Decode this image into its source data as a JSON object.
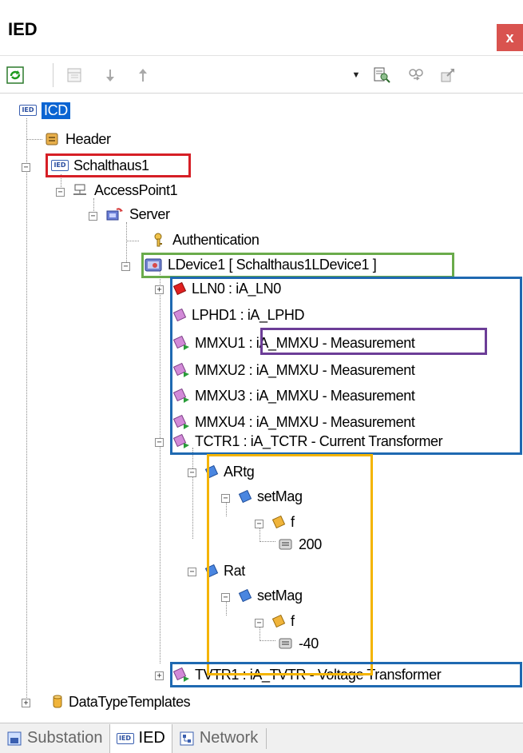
{
  "window": {
    "title": "IED",
    "close": "x"
  },
  "toolbar": {
    "icons": [
      "refresh-icon",
      "view-icon",
      "move-down-icon",
      "move-up-icon",
      "combo-dropdown",
      "find-icon",
      "find-next-icon",
      "export-icon"
    ],
    "combo_value": ""
  },
  "tree": {
    "root": "ICD",
    "header": "Header",
    "ied": "Schalthaus1",
    "access_point": "AccessPoint1",
    "server": "Server",
    "authentication": "Authentication",
    "ldevice": "LDevice1 [ Schalthaus1LDevice1 ]",
    "logical_nodes": [
      "LLN0 : iA_LN0",
      "LPHD1 : iA_LPHD",
      "MMXU1 : iA_MMXU - Measurement",
      "MMXU2 : iA_MMXU - Measurement",
      "MMXU3 : iA_MMXU - Measurement",
      "MMXU4 : iA_MMXU - Measurement",
      "TCTR1 : iA_TCTR - Current Transformer"
    ],
    "artg": "ARtg",
    "setmag1": "setMag",
    "f1": "f",
    "val1": "200",
    "rat": "Rat",
    "setmag2": "setMag",
    "f2": "f",
    "val2": "-40",
    "tvtr": "TVTR1 : iA_TVTR - Voltage Transformer",
    "templates": "DataTypeTemplates"
  },
  "highlight_colors": {
    "red": "#d61f26",
    "green": "#6aab4b",
    "blue": "#1f69b1",
    "purple": "#6c3d97",
    "yellow": "#f4b400"
  },
  "tabs": [
    {
      "label": "Substation",
      "icon": "substation-icon",
      "active": false
    },
    {
      "label": "IED",
      "icon": "ied-icon",
      "active": true
    },
    {
      "label": "Network",
      "icon": "network-icon",
      "active": false
    }
  ]
}
